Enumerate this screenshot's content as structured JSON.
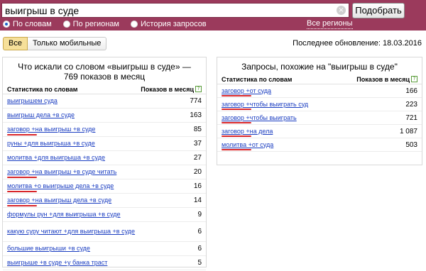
{
  "search": {
    "value": "выигрыш в суде",
    "button": "Подобрать"
  },
  "modes": [
    {
      "label": "По словам",
      "checked": true
    },
    {
      "label": "По регионам",
      "checked": false
    },
    {
      "label": "История запросов",
      "checked": false
    }
  ],
  "regions_link": "Все регионы",
  "tabs": [
    {
      "label": "Все",
      "active": true
    },
    {
      "label": "Только мобильные",
      "active": false
    }
  ],
  "updated": "Последнее обновление: 18.03.2016",
  "left_panel": {
    "title": "Что искали со словом «выигрыш в суде» — 769 показов в месяц",
    "col_query": "Статистика по словам",
    "col_count": "Показов в месяц",
    "rows": [
      {
        "q": "выигрышем суда",
        "n": "774"
      },
      {
        "q": "выигрыш дела +в суде",
        "n": "163"
      },
      {
        "q": "заговор +на выигрыш +в суде",
        "n": "85"
      },
      {
        "q": "руны +для выигрыша +в суде",
        "n": "37"
      },
      {
        "q": "молитва +для выигрыша +в суде",
        "n": "27"
      },
      {
        "q": "заговор +на выигрыш +в суде читать",
        "n": "20"
      },
      {
        "q": "молитва +о выигрыше дела +в суде",
        "n": "16"
      },
      {
        "q": "заговор +на выигрыш дела +в суде",
        "n": "14"
      },
      {
        "q": "формулы рун +для выигрыша +в суде",
        "n": "9"
      },
      {
        "q": "какую суру читают +для выигрыша +в суде",
        "n": "6"
      },
      {
        "q": "большие выигрыши +в суде",
        "n": "6"
      },
      {
        "q": "выигрыше +в суде +у банка траст",
        "n": "5"
      }
    ]
  },
  "right_panel": {
    "title": "Запросы, похожие на \"выигрыш в суде\"",
    "col_query": "Статистика по словам",
    "col_count": "Показов в месяц",
    "rows": [
      {
        "q": "заговор +от суда",
        "n": "166"
      },
      {
        "q": "заговор +чтобы выиграть суд",
        "n": "223"
      },
      {
        "q": "заговор +чтобы выиграть",
        "n": "721"
      },
      {
        "q": "заговор +на дела",
        "n": "1 087"
      },
      {
        "q": "молитва +от суда",
        "n": "503"
      }
    ]
  },
  "colors": {
    "header": "#9b3a5c",
    "link": "#1a3dc1",
    "annotation": "#d8262a"
  }
}
